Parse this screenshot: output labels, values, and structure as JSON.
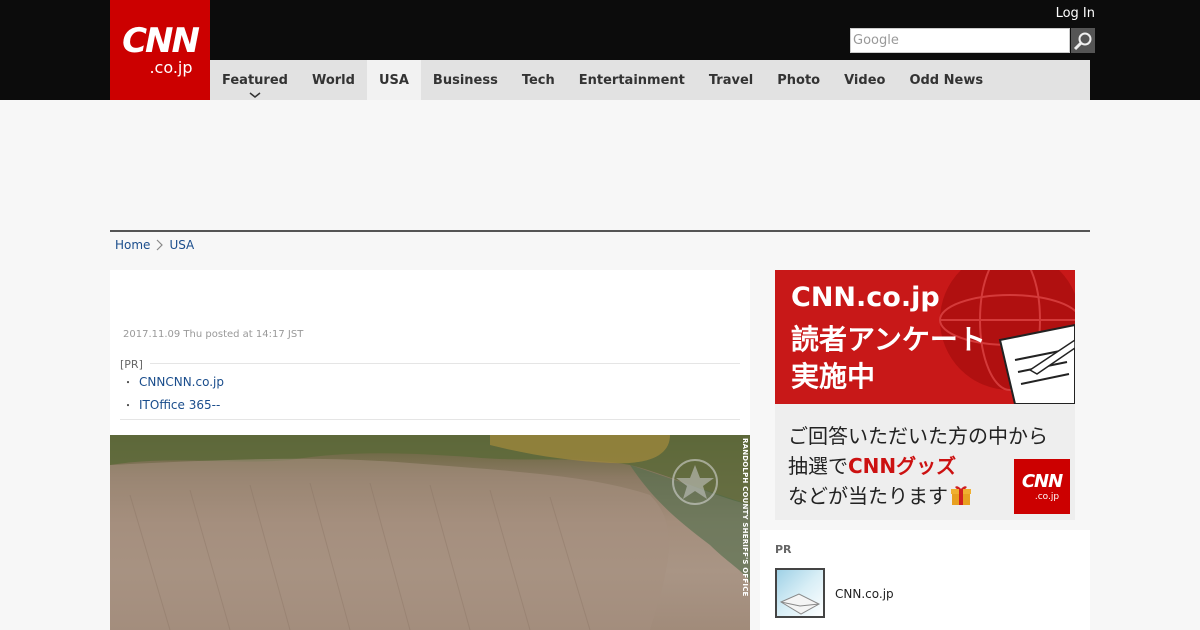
{
  "header": {
    "logo_main": "CNN",
    "logo_sub": ".co.jp",
    "login_label": "Log In",
    "search_placeholder": "Google"
  },
  "nav": {
    "items": [
      {
        "label": "Featured"
      },
      {
        "label": "World"
      },
      {
        "label": "USA"
      },
      {
        "label": "Business"
      },
      {
        "label": "Tech"
      },
      {
        "label": "Entertainment"
      },
      {
        "label": "Travel"
      },
      {
        "label": "Photo"
      },
      {
        "label": "Video"
      },
      {
        "label": "Odd News"
      }
    ],
    "active": "USA"
  },
  "breadcrumb": {
    "home": "Home",
    "current": "USA"
  },
  "article": {
    "date": "2017.11.09 Thu posted at 14:17 JST",
    "pr_label": "[PR]",
    "pr_links": [
      {
        "text": "CNNCNN.co.jp"
      },
      {
        "text": "ITOffice 365--"
      }
    ],
    "photo_credit": "RANDOLPH COUNTY SHERIFF'S OFFICE"
  },
  "banner": {
    "line1": "CNN.co.jp",
    "line2": "読者アンケート",
    "line3": "実施中",
    "line4": "ご回答いただいた方の中から",
    "line5_pre": "抽選で",
    "line5_red": "CNNグッズ",
    "line6": "などが当たります",
    "mini_logo_main": "CNN",
    "mini_logo_sub": ".co.jp"
  },
  "sidebox": {
    "pr": "PR",
    "item_label": "CNN.co.jp"
  },
  "colors": {
    "brand_red": "#cc0000",
    "link_blue": "#1a4d8c",
    "nav_bg": "#e2e2e2",
    "topbar_bg": "#0c0c0c"
  }
}
